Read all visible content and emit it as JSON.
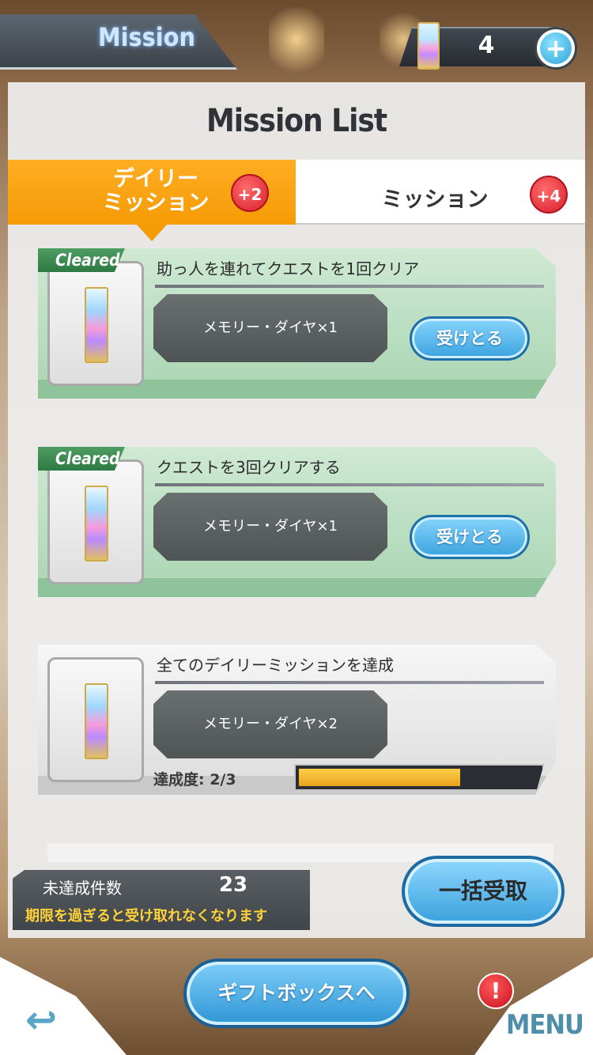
{
  "header": {
    "title": "Mission",
    "currency_value": "4",
    "currency_icon": "memory-diamond-icon",
    "add_icon": "plus-icon"
  },
  "panel": {
    "title": "Mission List"
  },
  "tabs": [
    {
      "label": "デイリー\nミッション",
      "badge": "+2",
      "active": true
    },
    {
      "label": "ミッション",
      "badge": "+4",
      "active": false
    }
  ],
  "missions": [
    {
      "title": "助っ人を連れてクエストを1回クリア",
      "reward": "メモリー・ダイヤ×1",
      "status": "Cleared",
      "button": "受けとる"
    },
    {
      "title": "クエストを3回クリアする",
      "reward": "メモリー・ダイヤ×1",
      "status": "Cleared",
      "button": "受けとる"
    },
    {
      "title": "全てのデイリーミッションを達成",
      "reward": "メモリー・ダイヤ×2",
      "progress_label": "達成度: 2/3",
      "progress": 0.67
    }
  ],
  "footer": {
    "unfinished_label": "未達成件数",
    "unfinished_count": "23",
    "warning": "期限を過ぎると受け取れなくなります",
    "bulk_button": "一括受取"
  },
  "nav": {
    "gift_button": "ギフトボックスへ",
    "menu": "MENU",
    "alert": "!",
    "back_icon": "back-arrow-icon"
  },
  "colors": {
    "accent_orange": "#f59b06",
    "cleared_green": "#a9d5b2",
    "button_blue": "#3ba3df",
    "badge_red": "#d81e2c",
    "progress_yellow": "#e9a21b"
  }
}
